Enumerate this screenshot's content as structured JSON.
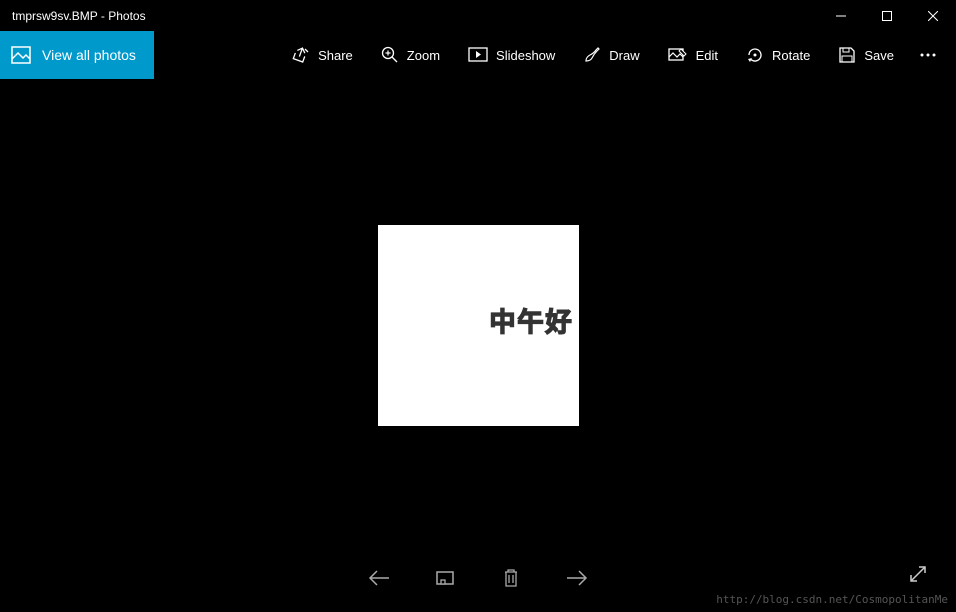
{
  "window": {
    "title": "tmprsw9sv.BMP - Photos"
  },
  "toolbar": {
    "view_all_label": "View all photos",
    "share_label": "Share",
    "zoom_label": "Zoom",
    "slideshow_label": "Slideshow",
    "draw_label": "Draw",
    "edit_label": "Edit",
    "rotate_label": "Rotate",
    "save_label": "Save"
  },
  "photo": {
    "text": "中午好"
  },
  "watermark": "http://blog.csdn.net/CosmopolitanMe"
}
